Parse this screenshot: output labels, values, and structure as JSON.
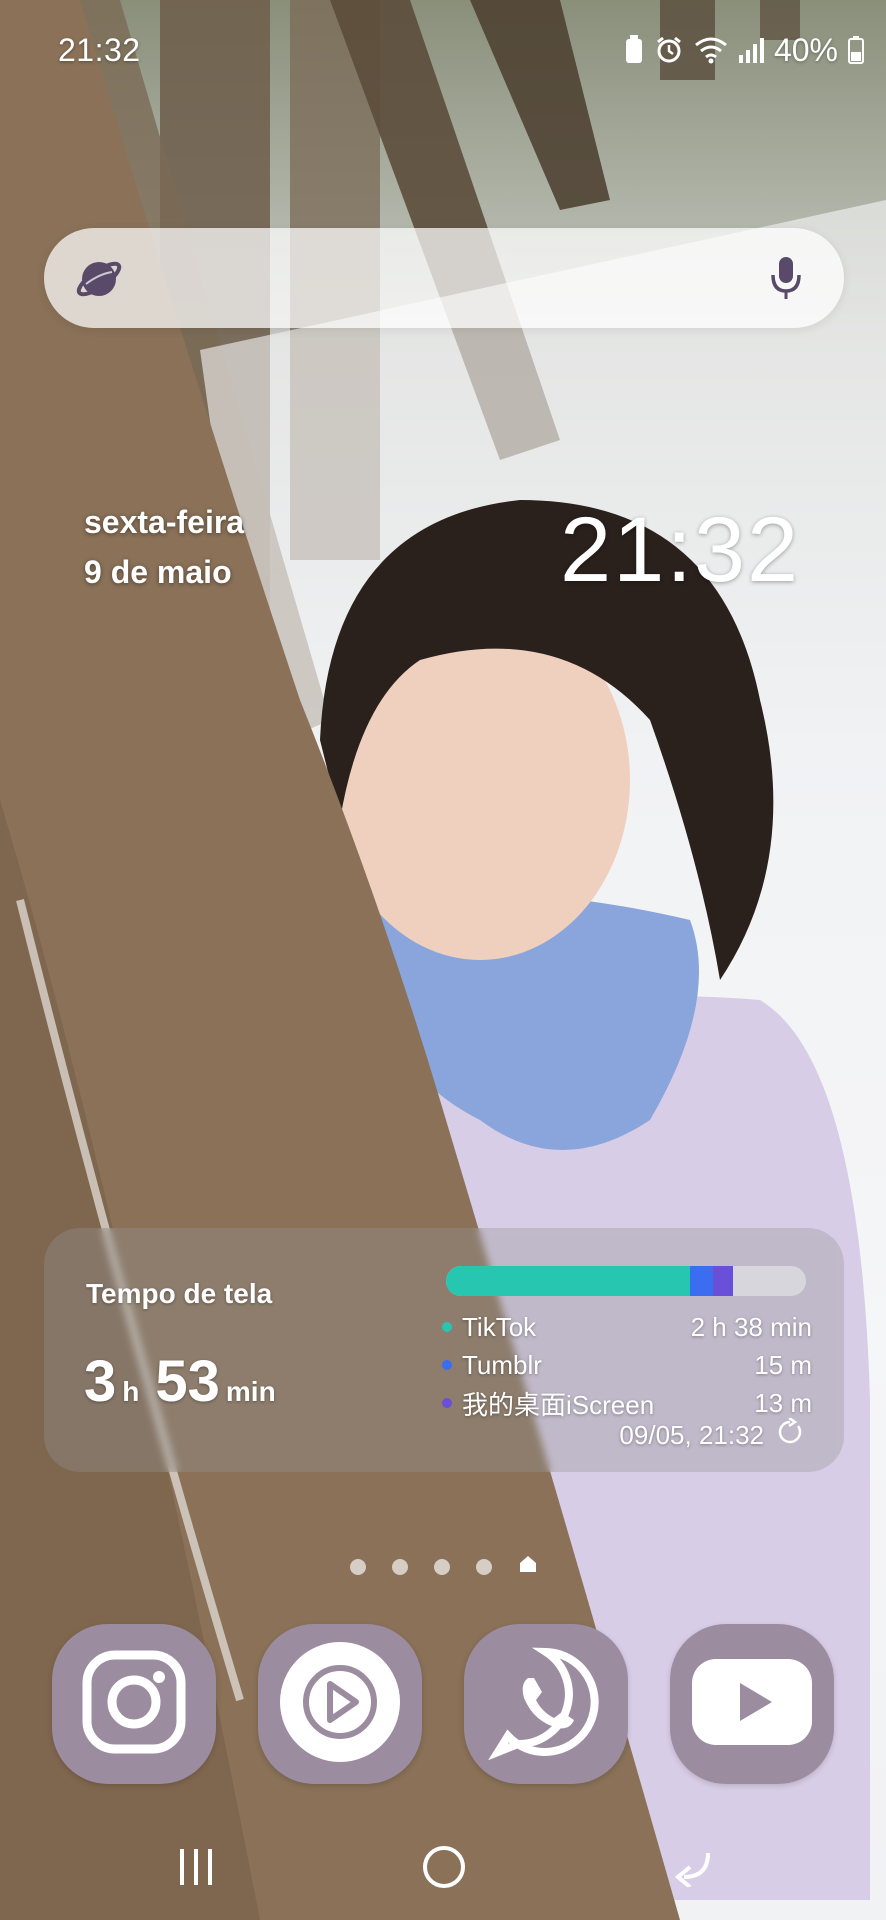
{
  "status_bar": {
    "time": "21:32",
    "battery_percent": "40%",
    "icons": [
      "battery-saver-icon",
      "alarm-icon",
      "wifi-icon",
      "signal-icon",
      "battery-icon"
    ]
  },
  "search_bar": {
    "logo_icon": "planet-icon",
    "mic_icon": "microphone-icon"
  },
  "date_widget": {
    "weekday": "sexta-feira",
    "date": "9 de maio",
    "clock": "21:32"
  },
  "screen_time": {
    "title": "Tempo de tela",
    "total_hours": "3",
    "hours_unit": "h",
    "total_minutes": "53",
    "minutes_unit": "min",
    "apps": [
      {
        "name": "TikTok",
        "time": "2 h 38 min",
        "minutes": 158,
        "color": "#26c6b0"
      },
      {
        "name": "Tumblr",
        "time": "15 m",
        "minutes": 15,
        "color": "#3b6df0"
      },
      {
        "name": "我的桌面iScreen",
        "time": "13 m",
        "minutes": 13,
        "color": "#6a4fd8"
      }
    ],
    "total_minutes_value": 233,
    "updated": "09/05, 21:32",
    "refresh_icon": "refresh-icon"
  },
  "pager": {
    "pages": 5,
    "current": 4
  },
  "dock": {
    "apps": [
      {
        "name": "Instagram",
        "icon": "instagram-icon"
      },
      {
        "name": "Player",
        "icon": "play-circle-icon"
      },
      {
        "name": "WhatsApp",
        "icon": "whatsapp-icon"
      },
      {
        "name": "YouTube",
        "icon": "youtube-icon"
      }
    ],
    "tile_color": "#9c8ca0"
  },
  "nav_bar": {
    "buttons": [
      "recent-apps-icon",
      "home-icon",
      "back-icon"
    ]
  }
}
